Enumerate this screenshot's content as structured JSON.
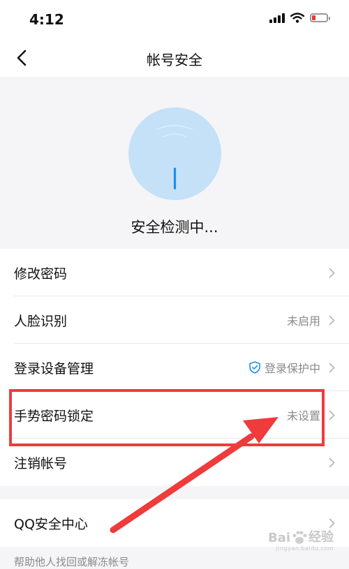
{
  "status_bar": {
    "time": "4:12"
  },
  "header": {
    "title": "帐号安全"
  },
  "hero": {
    "status_text": "安全检测中..."
  },
  "settings": [
    {
      "label": "修改密码",
      "value": ""
    },
    {
      "label": "人脸识别",
      "value": "未启用"
    },
    {
      "label": "登录设备管理",
      "value": "登录保护中",
      "icon": "shield-check-icon"
    },
    {
      "label": "手势密码锁定",
      "value": "未设置"
    },
    {
      "label": "注销帐号",
      "value": ""
    }
  ],
  "security_center": {
    "label": "QQ安全中心"
  },
  "footer": {
    "hint": "帮助他人找回或解冻帐号"
  },
  "watermark": {
    "brand": "Bai",
    "brand2": "经验",
    "url": "jingyan.baidu.com"
  },
  "colors": {
    "annotation": "#ef3b3b",
    "accent": "#1d8fe8",
    "circle": "#c5e1f7"
  }
}
